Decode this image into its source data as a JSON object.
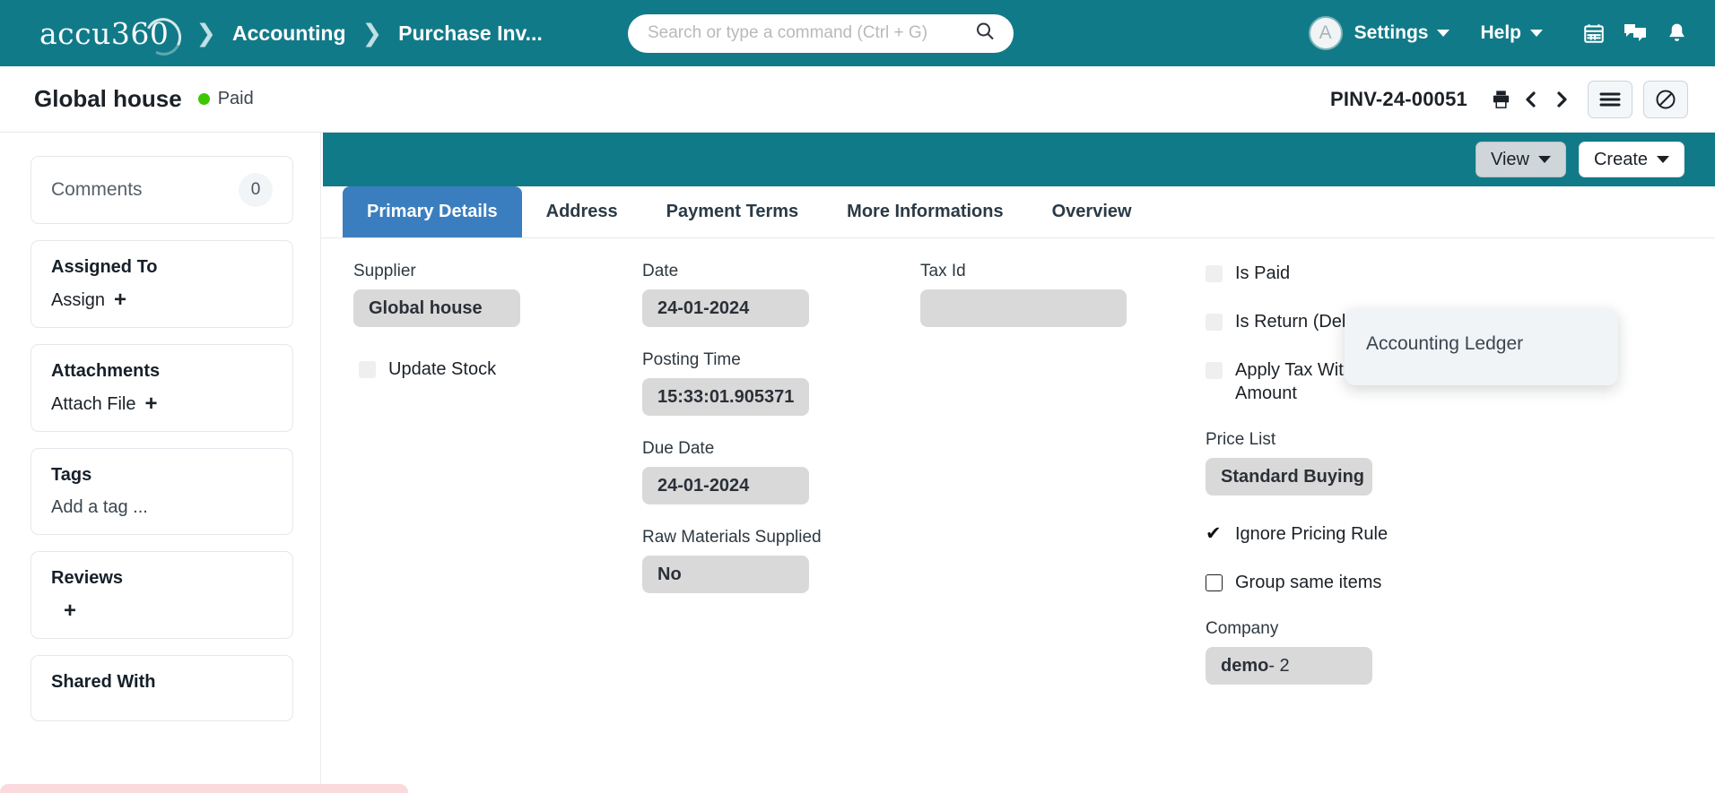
{
  "navbar": {
    "logo_text": "accu360",
    "breadcrumbs": [
      {
        "label": "Accounting"
      },
      {
        "label": "Purchase Inv..."
      }
    ],
    "search": {
      "value": "",
      "placeholder": "Search or type a command (Ctrl + G)"
    },
    "avatar_initial": "A",
    "settings_label": "Settings",
    "help_label": "Help",
    "icons": [
      "search-icon",
      "calendar-icon",
      "chat-icon",
      "bell-icon"
    ],
    "background_color": "#117a88"
  },
  "doc_header": {
    "title": "Global house",
    "status": "Paid",
    "status_color": "#3ec700",
    "doc_id": "PINV-24-00051",
    "print_icon": "printer-icon",
    "prev_icon": "chevron-left-icon",
    "next_icon": "chevron-right-icon",
    "menu_icon": "hamburger-menu-icon",
    "cancel_icon": "circle-slash-icon"
  },
  "sidebar": {
    "comments": {
      "label": "Comments",
      "count": "0"
    },
    "assigned_to": {
      "title": "Assigned To",
      "action": "Assign",
      "plus": "+"
    },
    "attachments": {
      "title": "Attachments",
      "action": "Attach File",
      "plus": "+"
    },
    "tags": {
      "title": "Tags",
      "action": "Add a tag ..."
    },
    "reviews": {
      "title": "Reviews",
      "plus": "+"
    },
    "shared_with": {
      "title": "Shared With"
    }
  },
  "toolbar": {
    "view_label": "View",
    "create_label": "Create",
    "dropdown_items": [
      {
        "label": "Accounting Ledger"
      }
    ]
  },
  "tabs": [
    {
      "label": "Primary Details",
      "active": true
    },
    {
      "label": "Address",
      "active": false
    },
    {
      "label": "Payment Terms",
      "active": false
    },
    {
      "label": "More Informations",
      "active": false
    },
    {
      "label": "Overview",
      "active": false
    }
  ],
  "form": {
    "column_1": {
      "supplier": {
        "label": "Supplier",
        "value": "Global house"
      },
      "update_stock": {
        "label": "Update Stock",
        "checked": false,
        "disabled": true
      }
    },
    "column_2": {
      "date": {
        "label": "Date",
        "value": "24-01-2024"
      },
      "posting_time": {
        "label": "Posting Time",
        "value": "15:33:01.905371"
      },
      "due_date": {
        "label": "Due Date",
        "value": "24-01-2024"
      },
      "raw_materials_supplied": {
        "label": "Raw Materials Supplied",
        "value": "No"
      }
    },
    "column_3": {
      "tax_id": {
        "label": "Tax Id",
        "value": ""
      }
    },
    "column_4": {
      "is_paid": {
        "label": "Is Paid",
        "checked": false,
        "disabled": true
      },
      "is_return": {
        "label": "Is Return (Debit Note)",
        "checked": false,
        "disabled": true
      },
      "apply_tax_withholding": {
        "label": "Apply Tax Withholding Amount",
        "checked": false,
        "disabled": true
      },
      "price_list": {
        "label": "Price List",
        "value": "Standard Buying"
      },
      "ignore_pricing_rule": {
        "label": "Ignore Pricing Rule",
        "checked": true
      },
      "group_same_items": {
        "label": "Group same items",
        "checked": false
      },
      "company": {
        "label": "Company",
        "value_bold": "demo",
        "value_rest": " - 2"
      }
    }
  }
}
